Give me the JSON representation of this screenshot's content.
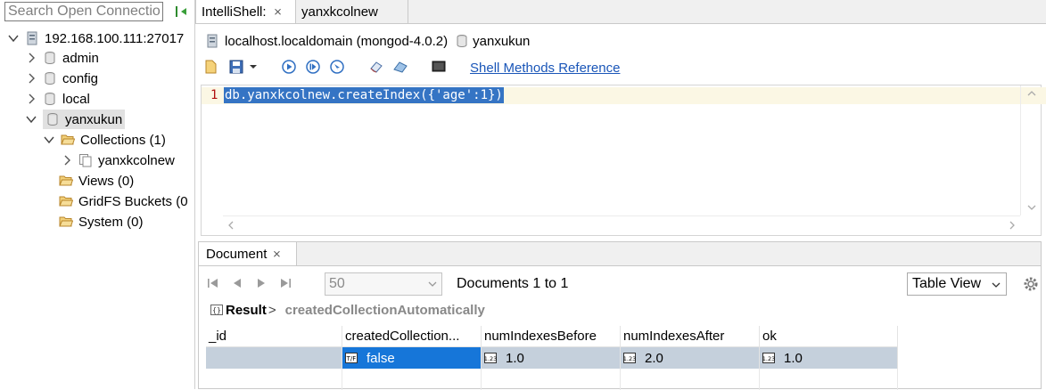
{
  "search": {
    "placeholder": "Search Open Connectio"
  },
  "tree": {
    "server": "192.168.100.111:27017",
    "dbs": [
      "admin",
      "config",
      "local"
    ],
    "selected_db": "yanxukun",
    "collections": "Collections (1)",
    "collection_item": "yanxkcolnew",
    "views": "Views (0)",
    "gridfs": "GridFS Buckets (0",
    "system": "System (0)"
  },
  "tabs": [
    {
      "label": "IntelliShell:"
    },
    {
      "label": "yanxkcolnew"
    }
  ],
  "connection": {
    "host": "localhost.localdomain (mongod-4.0.2)",
    "db": "yanxukun"
  },
  "toolbar": {
    "shell_link": "Shell Methods Reference"
  },
  "editor": {
    "line_number": "1",
    "code": "db.yanxkcolnew.createIndex({'age':1})"
  },
  "doc_panel": {
    "tab": "Document",
    "limit": "50",
    "range": "Documents 1 to 1",
    "view": "Table View",
    "result_label": "Result",
    "result_sep": ">",
    "result_path": "createdCollectionAutomatically"
  },
  "table": {
    "columns": [
      "_id",
      "createdCollection...",
      "numIndexesBefore",
      "numIndexesAfter",
      "ok"
    ],
    "rows": [
      [
        "",
        "false",
        "1.0",
        "2.0",
        "1.0"
      ]
    ]
  },
  "colors": {
    "selection": "#1676d9",
    "editor_highlight": "#3574c4",
    "link": "#1a56b8",
    "folder": "#e3b14a"
  }
}
